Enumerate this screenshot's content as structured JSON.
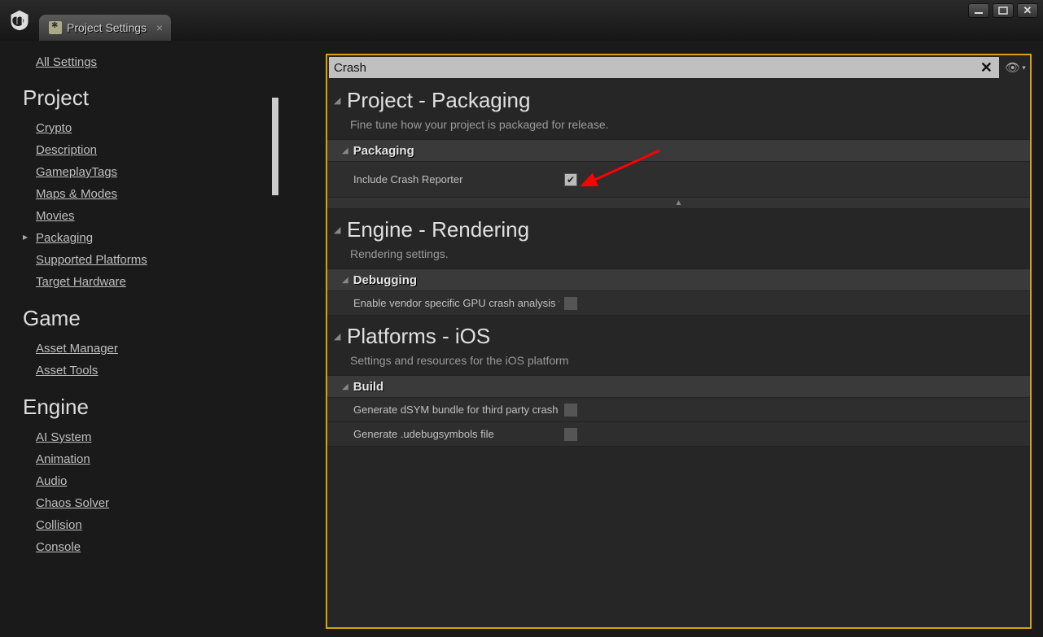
{
  "tab": {
    "title": "Project Settings"
  },
  "search": {
    "value": "Crash"
  },
  "sidebar": {
    "all_settings": "All Settings",
    "groups": [
      {
        "header": "Project",
        "items": [
          "Crypto",
          "Description",
          "GameplayTags",
          "Maps & Modes",
          "Movies",
          "Packaging",
          "Supported Platforms",
          "Target Hardware"
        ],
        "selected": "Packaging"
      },
      {
        "header": "Game",
        "items": [
          "Asset Manager",
          "Asset Tools"
        ]
      },
      {
        "header": "Engine",
        "items": [
          "AI System",
          "Animation",
          "Audio",
          "Chaos Solver",
          "Collision",
          "Console"
        ]
      }
    ]
  },
  "sections": [
    {
      "title": "Project - Packaging",
      "desc": "Fine tune how your project is packaged for release.",
      "groups": [
        {
          "title": "Packaging",
          "props": [
            {
              "label": "Include Crash Reporter",
              "checked": true
            }
          ],
          "expander": true
        }
      ]
    },
    {
      "title": "Engine - Rendering",
      "desc": "Rendering settings.",
      "groups": [
        {
          "title": "Debugging",
          "props": [
            {
              "label": "Enable vendor specific GPU crash analysis tools",
              "checked": false
            }
          ]
        }
      ]
    },
    {
      "title": "Platforms - iOS",
      "desc": "Settings and resources for the iOS platform",
      "groups": [
        {
          "title": "Build",
          "props": [
            {
              "label": "Generate dSYM bundle for third party crash tools",
              "checked": false
            },
            {
              "label": "Generate .udebugsymbols file",
              "checked": false
            }
          ]
        }
      ]
    }
  ]
}
